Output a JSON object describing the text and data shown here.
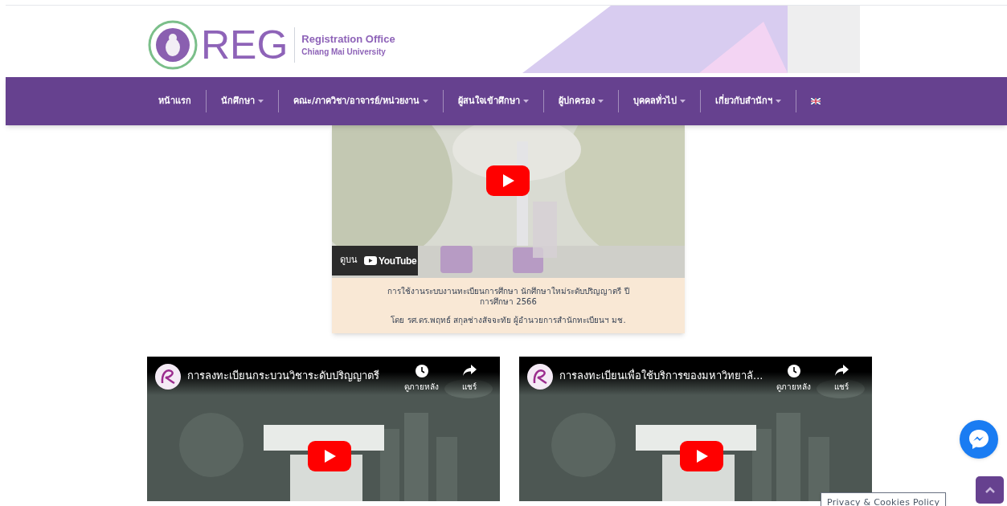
{
  "header": {
    "logo_text": "REG",
    "subtitle_1": "Registration Office",
    "subtitle_2": "Chiang Mai University"
  },
  "nav": [
    {
      "kind": "link",
      "label": "หน้าแรก",
      "dropdown": false
    },
    {
      "kind": "link",
      "label": "นักศึกษา",
      "dropdown": true
    },
    {
      "kind": "link",
      "label": "คณะ/ภาควิชา/อาจารย์/หน่วยงาน",
      "dropdown": true
    },
    {
      "kind": "link",
      "label": "ผู้สนใจเข้าศึกษา",
      "dropdown": true
    },
    {
      "kind": "link",
      "label": "ผู้ปกครอง",
      "dropdown": true
    },
    {
      "kind": "link",
      "label": "บุคคลทั่วไป",
      "dropdown": true
    },
    {
      "kind": "link",
      "label": "เกี่ยวกับสำนักฯ",
      "dropdown": true
    },
    {
      "kind": "flag"
    }
  ],
  "featured_video": {
    "watch_on": "ดูบน",
    "platform": "YouTube",
    "caption": [
      "การใช้งานระบบงานทะเบียนการศึกษา นักศึกษาใหม่ระดับปริญญาตรี ปีการศึกษา 2566",
      "โดย รศ.ดร.พฤทธ์ สกุลช่างสัจจะทัย ผู้อำนวยการสำนักทะเบียนฯ มช."
    ]
  },
  "videos": [
    {
      "title": "การลงทะเบียนกระบวนวิชาระดับปริญญาตรี",
      "watch_later": "ดูภายหลัง",
      "share": "แชร์"
    },
    {
      "title": "การลงทะเบียนเพื่อใช้บริการของมหาวิทยาลั...",
      "watch_later": "ดูภายหลัง",
      "share": "แชร์"
    }
  ],
  "privacy_tab": "Privacy & Cookies Policy"
}
